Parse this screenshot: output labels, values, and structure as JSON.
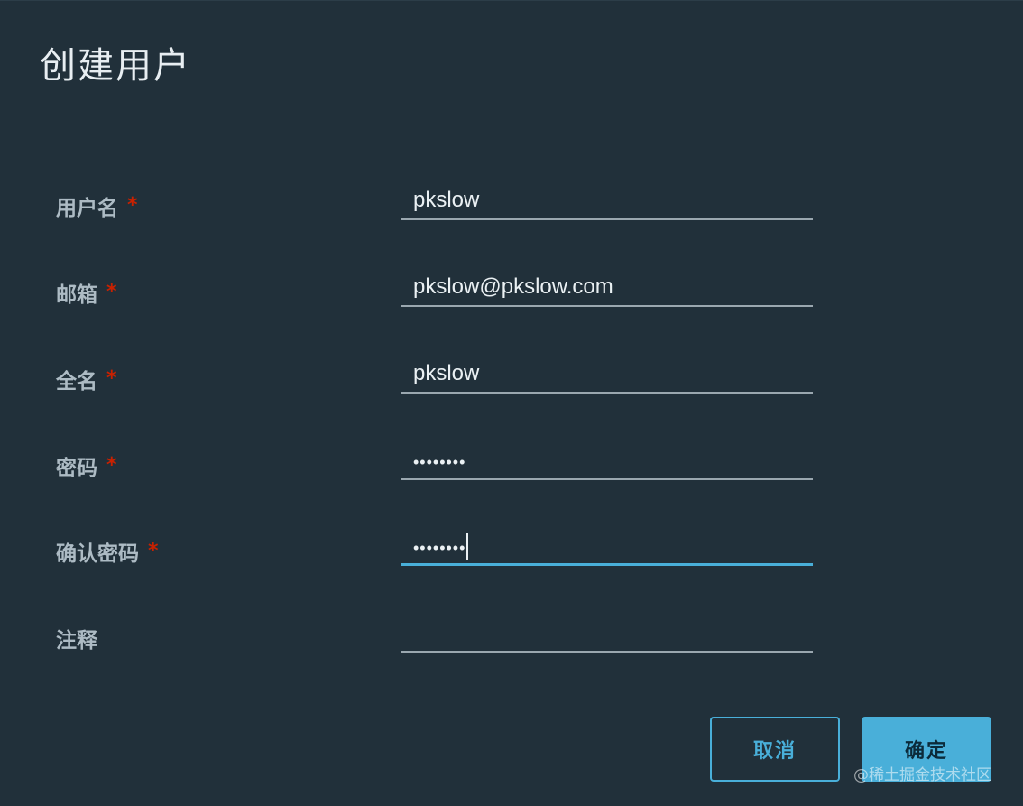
{
  "dialog": {
    "title": "创建用户"
  },
  "form": {
    "required_mark": "*",
    "fields": [
      {
        "label": "用户名",
        "value": "pkslow",
        "required": true
      },
      {
        "label": "邮箱",
        "value": "pkslow@pkslow.com",
        "required": true
      },
      {
        "label": "全名",
        "value": "pkslow",
        "required": true
      },
      {
        "label": "密码",
        "value": "••••••••",
        "required": true
      },
      {
        "label": "确认密码",
        "value": "••••••••",
        "required": true
      },
      {
        "label": "注释",
        "value": "",
        "required": false
      }
    ]
  },
  "buttons": {
    "cancel_label": "取消",
    "ok_label": "确定"
  },
  "watermark": "@稀土掘金技术社区",
  "colors": {
    "background": "#21303a",
    "accent": "#49afd9",
    "required": "#c92100",
    "label": "#adbbc4"
  }
}
